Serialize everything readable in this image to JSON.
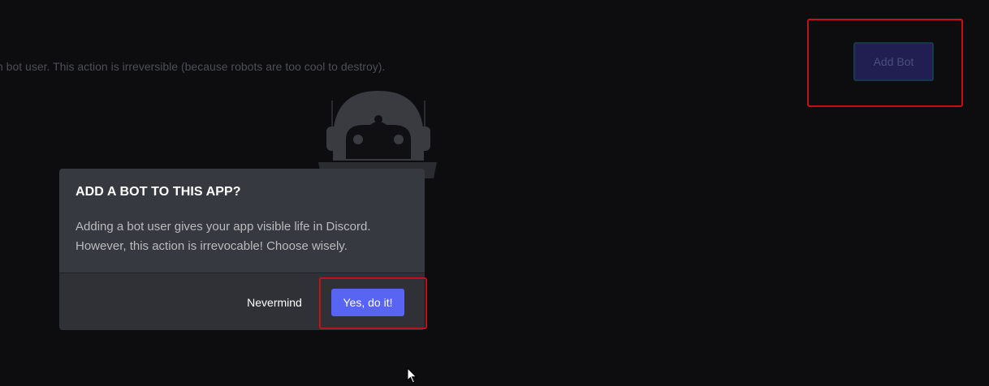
{
  "background": {
    "description": "n bot user. This action is irreversible (because robots are too cool to destroy).",
    "add_bot_label": "Add Bot"
  },
  "modal": {
    "title": "ADD A BOT TO THIS APP?",
    "body_line1": "Adding a bot user gives your app visible life in Discord.",
    "body_line2": "However, this action is irrevocable! Choose wisely.",
    "cancel_label": "Nevermind",
    "confirm_label": "Yes, do it!"
  },
  "colors": {
    "confirm_accent": "#5865f2",
    "highlight": "#c1121b",
    "modal_background": "#36393f",
    "modal_footer": "#2f3136"
  },
  "icons": {
    "robot": "robot-illustration-icon",
    "cursor": "mouse-pointer-icon"
  }
}
